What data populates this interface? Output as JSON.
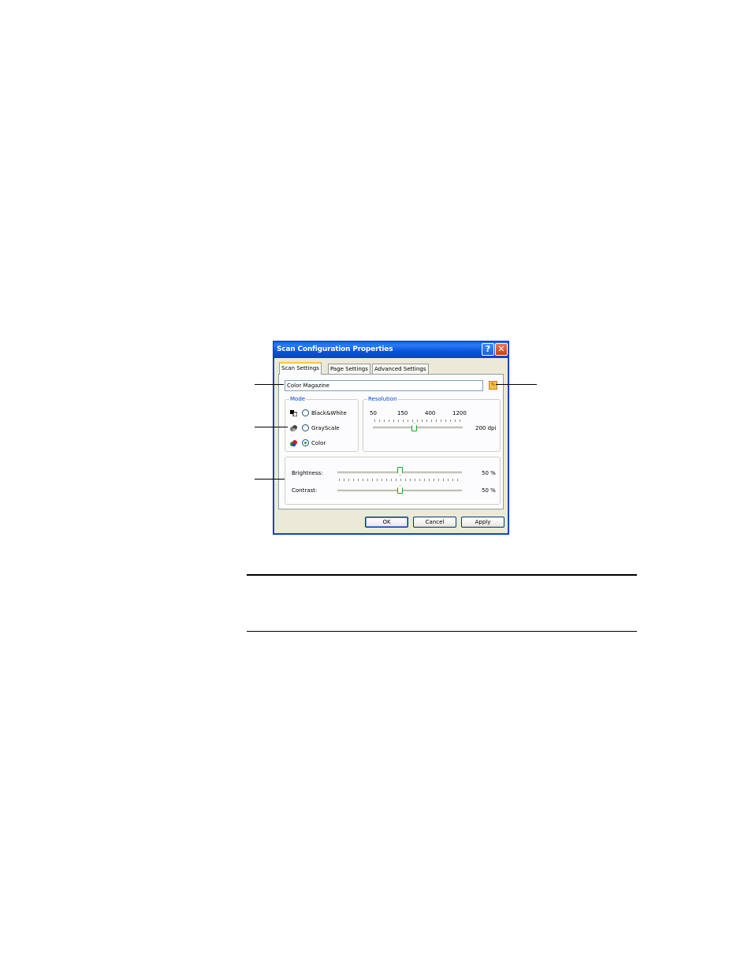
{
  "window": {
    "title": "Scan Configuration Properties",
    "help_glyph": "?",
    "close_glyph": "✕"
  },
  "tabs": [
    {
      "label": "Scan Settings",
      "active": true
    },
    {
      "label": "Page Settings",
      "active": false
    },
    {
      "label": "Advanced Settings",
      "active": false
    }
  ],
  "config_name": {
    "value": "Color Magazine",
    "edit_icon": "edit-folder-icon"
  },
  "mode": {
    "legend": "Mode",
    "options": [
      {
        "label": "Black&White",
        "icon": "black-white-icon",
        "selected": false
      },
      {
        "label": "GrayScale",
        "icon": "grayscale-icon",
        "selected": false
      },
      {
        "label": "Color",
        "icon": "color-icon",
        "selected": true
      }
    ]
  },
  "resolution": {
    "legend": "Resolution",
    "marks": [
      "50",
      "150",
      "400",
      "1200"
    ],
    "value_text": "200 dpi",
    "value": 200
  },
  "adjust": {
    "brightness_label": "Brightness:",
    "brightness_value": "50 %",
    "brightness": 50,
    "contrast_label": "Contrast:",
    "contrast_value": "50 %",
    "contrast": 50
  },
  "buttons": {
    "ok": "OK",
    "cancel": "Cancel",
    "apply": "Apply"
  },
  "colors": {
    "title_bar": "#0a5ef0",
    "face": "#ece9d8",
    "accent": "#21a121",
    "legend": "#0046d5"
  }
}
